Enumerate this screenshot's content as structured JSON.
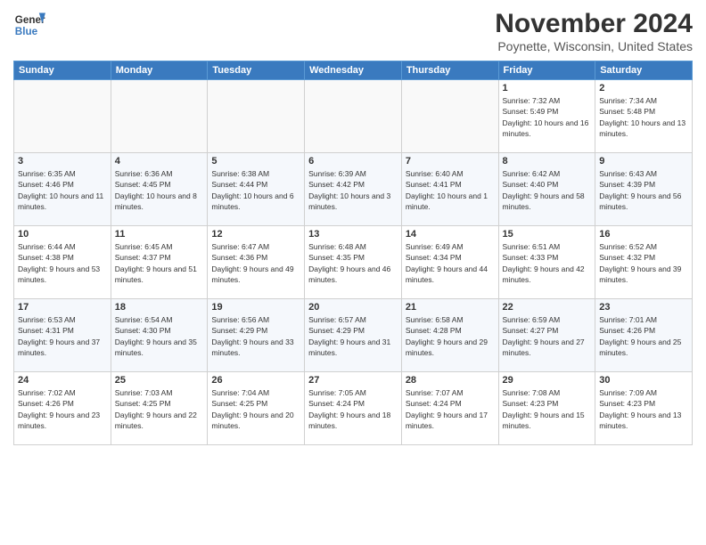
{
  "header": {
    "logo_line1": "General",
    "logo_line2": "Blue",
    "title": "November 2024",
    "location": "Poynette, Wisconsin, United States"
  },
  "days_of_week": [
    "Sunday",
    "Monday",
    "Tuesday",
    "Wednesday",
    "Thursday",
    "Friday",
    "Saturday"
  ],
  "weeks": [
    [
      {
        "day": "",
        "info": ""
      },
      {
        "day": "",
        "info": ""
      },
      {
        "day": "",
        "info": ""
      },
      {
        "day": "",
        "info": ""
      },
      {
        "day": "",
        "info": ""
      },
      {
        "day": "1",
        "info": "Sunrise: 7:32 AM\nSunset: 5:49 PM\nDaylight: 10 hours and 16 minutes."
      },
      {
        "day": "2",
        "info": "Sunrise: 7:34 AM\nSunset: 5:48 PM\nDaylight: 10 hours and 13 minutes."
      }
    ],
    [
      {
        "day": "3",
        "info": "Sunrise: 6:35 AM\nSunset: 4:46 PM\nDaylight: 10 hours and 11 minutes."
      },
      {
        "day": "4",
        "info": "Sunrise: 6:36 AM\nSunset: 4:45 PM\nDaylight: 10 hours and 8 minutes."
      },
      {
        "day": "5",
        "info": "Sunrise: 6:38 AM\nSunset: 4:44 PM\nDaylight: 10 hours and 6 minutes."
      },
      {
        "day": "6",
        "info": "Sunrise: 6:39 AM\nSunset: 4:42 PM\nDaylight: 10 hours and 3 minutes."
      },
      {
        "day": "7",
        "info": "Sunrise: 6:40 AM\nSunset: 4:41 PM\nDaylight: 10 hours and 1 minute."
      },
      {
        "day": "8",
        "info": "Sunrise: 6:42 AM\nSunset: 4:40 PM\nDaylight: 9 hours and 58 minutes."
      },
      {
        "day": "9",
        "info": "Sunrise: 6:43 AM\nSunset: 4:39 PM\nDaylight: 9 hours and 56 minutes."
      }
    ],
    [
      {
        "day": "10",
        "info": "Sunrise: 6:44 AM\nSunset: 4:38 PM\nDaylight: 9 hours and 53 minutes."
      },
      {
        "day": "11",
        "info": "Sunrise: 6:45 AM\nSunset: 4:37 PM\nDaylight: 9 hours and 51 minutes."
      },
      {
        "day": "12",
        "info": "Sunrise: 6:47 AM\nSunset: 4:36 PM\nDaylight: 9 hours and 49 minutes."
      },
      {
        "day": "13",
        "info": "Sunrise: 6:48 AM\nSunset: 4:35 PM\nDaylight: 9 hours and 46 minutes."
      },
      {
        "day": "14",
        "info": "Sunrise: 6:49 AM\nSunset: 4:34 PM\nDaylight: 9 hours and 44 minutes."
      },
      {
        "day": "15",
        "info": "Sunrise: 6:51 AM\nSunset: 4:33 PM\nDaylight: 9 hours and 42 minutes."
      },
      {
        "day": "16",
        "info": "Sunrise: 6:52 AM\nSunset: 4:32 PM\nDaylight: 9 hours and 39 minutes."
      }
    ],
    [
      {
        "day": "17",
        "info": "Sunrise: 6:53 AM\nSunset: 4:31 PM\nDaylight: 9 hours and 37 minutes."
      },
      {
        "day": "18",
        "info": "Sunrise: 6:54 AM\nSunset: 4:30 PM\nDaylight: 9 hours and 35 minutes."
      },
      {
        "day": "19",
        "info": "Sunrise: 6:56 AM\nSunset: 4:29 PM\nDaylight: 9 hours and 33 minutes."
      },
      {
        "day": "20",
        "info": "Sunrise: 6:57 AM\nSunset: 4:29 PM\nDaylight: 9 hours and 31 minutes."
      },
      {
        "day": "21",
        "info": "Sunrise: 6:58 AM\nSunset: 4:28 PM\nDaylight: 9 hours and 29 minutes."
      },
      {
        "day": "22",
        "info": "Sunrise: 6:59 AM\nSunset: 4:27 PM\nDaylight: 9 hours and 27 minutes."
      },
      {
        "day": "23",
        "info": "Sunrise: 7:01 AM\nSunset: 4:26 PM\nDaylight: 9 hours and 25 minutes."
      }
    ],
    [
      {
        "day": "24",
        "info": "Sunrise: 7:02 AM\nSunset: 4:26 PM\nDaylight: 9 hours and 23 minutes."
      },
      {
        "day": "25",
        "info": "Sunrise: 7:03 AM\nSunset: 4:25 PM\nDaylight: 9 hours and 22 minutes."
      },
      {
        "day": "26",
        "info": "Sunrise: 7:04 AM\nSunset: 4:25 PM\nDaylight: 9 hours and 20 minutes."
      },
      {
        "day": "27",
        "info": "Sunrise: 7:05 AM\nSunset: 4:24 PM\nDaylight: 9 hours and 18 minutes."
      },
      {
        "day": "28",
        "info": "Sunrise: 7:07 AM\nSunset: 4:24 PM\nDaylight: 9 hours and 17 minutes."
      },
      {
        "day": "29",
        "info": "Sunrise: 7:08 AM\nSunset: 4:23 PM\nDaylight: 9 hours and 15 minutes."
      },
      {
        "day": "30",
        "info": "Sunrise: 7:09 AM\nSunset: 4:23 PM\nDaylight: 9 hours and 13 minutes."
      }
    ]
  ]
}
